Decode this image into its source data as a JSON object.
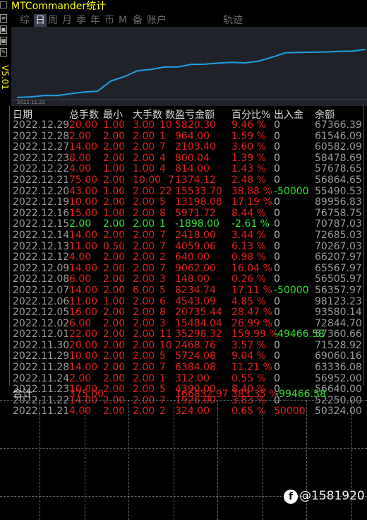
{
  "window": {
    "title": "MTCommander统计"
  },
  "sidebar": {
    "version": "V5.01"
  },
  "tabs": [
    {
      "label": "综"
    },
    {
      "label": "日"
    },
    {
      "label": "周"
    },
    {
      "label": "月"
    },
    {
      "label": "季"
    },
    {
      "label": "年"
    },
    {
      "label": "币"
    },
    {
      "label": "M"
    },
    {
      "label": "备"
    },
    {
      "label": "账户"
    },
    {
      "label": "轨迹"
    }
  ],
  "chart": {
    "date_label": "2022.11.21",
    "line_color": "#1ea0e6"
  },
  "chart_data": {
    "type": "line",
    "x": [
      "2022.11.21",
      "2022.11.22",
      "2022.11.23",
      "2022.11.24",
      "2022.11.25",
      "2022.11.28",
      "2022.11.29",
      "2022.11.30",
      "2022.12.01",
      "2022.12.02",
      "2022.12.05",
      "2022.12.06",
      "2022.12.07",
      "2022.12.08",
      "2022.12.09",
      "2022.12.12",
      "2022.12.13",
      "2022.12.14",
      "2022.12.15",
      "2022.12.16",
      "2022.12.19",
      "2022.12.20",
      "2022.12.21",
      "2022.12.22",
      "2022.12.23",
      "2022.12.27",
      "2022.12.28",
      "2022.12.29"
    ],
    "series": [
      {
        "values": [
          50324.0,
          52250.0,
          56640.0,
          56952.0,
          57289.0,
          63336.08,
          69060.16,
          71528.92,
          57360.66,
          72844.7,
          93580.14,
          98123.23,
          56357.97,
          56505.97,
          65567.97,
          66207.97,
          70267.03,
          72685.03,
          70787.03,
          76758.75,
          89956.83,
          55490.53,
          56864.65,
          57678.65,
          58478.69,
          60582.09,
          61546.09,
          67366.39
        ]
      }
    ],
    "title": "",
    "xlabel": "",
    "ylabel": ""
  },
  "table": {
    "headers": {
      "date": "日期",
      "lots": "总手数",
      "min": "最小",
      "max": "大手数",
      "count": "数",
      "pnl": "盈亏金额",
      "pct": "百分比%",
      "flow": "出入金",
      "balance": "余额"
    },
    "rows": [
      {
        "date": "2022.12.29",
        "lots": "20.00",
        "min": "1.00",
        "max": "3.00",
        "count": "10",
        "pnl": "5820.30",
        "pct": "9.46 %",
        "flow": "0",
        "balance": "67366.39",
        "color": "red"
      },
      {
        "date": "2022.12.28",
        "lots": "2.00",
        "min": "2.00",
        "max": "2.00",
        "count": "1",
        "pnl": "964.00",
        "pct": "1.59 %",
        "flow": "0",
        "balance": "61546.09",
        "color": "red"
      },
      {
        "date": "2022.12.27",
        "lots": "14.00",
        "min": "2.00",
        "max": "2.00",
        "count": "7",
        "pnl": "2103.40",
        "pct": "3.60 %",
        "flow": "0",
        "balance": "60582.09",
        "color": "red"
      },
      {
        "date": "2022.12.23",
        "lots": "8.00",
        "min": "2.00",
        "max": "2.00",
        "count": "4",
        "pnl": "800.04",
        "pct": "1.39 %",
        "flow": "0",
        "balance": "58478.69",
        "color": "red"
      },
      {
        "date": "2022.12.22",
        "lots": "4.00",
        "min": "1.00",
        "max": "1.00",
        "count": "4",
        "pnl": "814.00",
        "pct": "1.43 %",
        "flow": "0",
        "balance": "57678.65",
        "color": "red"
      },
      {
        "date": "2022.12.21",
        "lots": "75.00",
        "min": "2.00",
        "max": "10.00",
        "count": "7",
        "pnl": "1374.12",
        "pct": "2.48 %",
        "flow": "0",
        "balance": "56864.65",
        "color": "red"
      },
      {
        "date": "2022.12.20",
        "lots": "43.00",
        "min": "1.00",
        "max": "2.00",
        "count": "22",
        "pnl": "15533.70",
        "pct": "38.88 %",
        "flow": "-50000",
        "balance": "55490.53",
        "color": "red"
      },
      {
        "date": "2022.12.19",
        "lots": "10.00",
        "min": "2.00",
        "max": "2.00",
        "count": "5",
        "pnl": "13198.08",
        "pct": "17.19 %",
        "flow": "0",
        "balance": "89956.83",
        "color": "red"
      },
      {
        "date": "2022.12.16",
        "lots": "15.00",
        "min": "1.00",
        "max": "2.00",
        "count": "8",
        "pnl": "5971.72",
        "pct": "8.44 %",
        "flow": "0",
        "balance": "76758.75",
        "color": "red"
      },
      {
        "date": "2022.12.15",
        "lots": "2.00",
        "min": "2.00",
        "max": "2.00",
        "count": "1",
        "pnl": "-1898.00",
        "pct": "-2.61 %",
        "flow": "0",
        "balance": "70787.03",
        "color": "green"
      },
      {
        "date": "2022.12.14",
        "lots": "14.00",
        "min": "2.00",
        "max": "2.00",
        "count": "7",
        "pnl": "2418.00",
        "pct": "3.44 %",
        "flow": "0",
        "balance": "72685.03",
        "color": "red"
      },
      {
        "date": "2022.12.13",
        "lots": "11.00",
        "min": "0.50",
        "max": "2.00",
        "count": "7",
        "pnl": "4059.06",
        "pct": "6.13 %",
        "flow": "0",
        "balance": "70267.03",
        "color": "red"
      },
      {
        "date": "2022.12.12",
        "lots": "4.00",
        "min": "2.00",
        "max": "2.00",
        "count": "2",
        "pnl": "640.00",
        "pct": "0.98 %",
        "flow": "0",
        "balance": "66207.97",
        "color": "red"
      },
      {
        "date": "2022.12.09",
        "lots": "14.00",
        "min": "2.00",
        "max": "2.00",
        "count": "7",
        "pnl": "9062.00",
        "pct": "16.04 %",
        "flow": "0",
        "balance": "65567.97",
        "color": "red"
      },
      {
        "date": "2022.12.08",
        "lots": "6.00",
        "min": "2.00",
        "max": "2.00",
        "count": "3",
        "pnl": "148.00",
        "pct": "0.26 %",
        "flow": "0",
        "balance": "56505.97",
        "color": "red"
      },
      {
        "date": "2022.12.07",
        "lots": "14.00",
        "min": "2.00",
        "max": "6.00",
        "count": "5",
        "pnl": "8234.74",
        "pct": "17.11 %",
        "flow": "-50000",
        "balance": "56357.97",
        "color": "red"
      },
      {
        "date": "2022.12.06",
        "lots": "11.00",
        "min": "1.00",
        "max": "2.00",
        "count": "6",
        "pnl": "4543.09",
        "pct": "4.85 %",
        "flow": "0",
        "balance": "98123.23",
        "color": "red"
      },
      {
        "date": "2022.12.05",
        "lots": "16.00",
        "min": "2.00",
        "max": "2.00",
        "count": "8",
        "pnl": "20735.44",
        "pct": "28.47 %",
        "flow": "0",
        "balance": "93580.14",
        "color": "red"
      },
      {
        "date": "2022.12.02",
        "lots": "6.00",
        "min": "2.00",
        "max": "2.00",
        "count": "3",
        "pnl": "15484.04",
        "pct": "26.99 %",
        "flow": "0",
        "balance": "72844.70",
        "color": "red"
      },
      {
        "date": "2022.12.01",
        "lots": "22.00",
        "min": "2.00",
        "max": "2.00",
        "count": "11",
        "pnl": "35298.32",
        "pct": "159.99 %",
        "flow": "-49466.58",
        "balance": "57360.66",
        "color": "red"
      },
      {
        "date": "2022.11.30",
        "lots": "20.00",
        "min": "2.00",
        "max": "2.00",
        "count": "10",
        "pnl": "2468.76",
        "pct": "3.57 %",
        "flow": "0",
        "balance": "71528.92",
        "color": "red"
      },
      {
        "date": "2022.11.29",
        "lots": "10.00",
        "min": "2.00",
        "max": "2.00",
        "count": "5",
        "pnl": "5724.08",
        "pct": "9.04 %",
        "flow": "0",
        "balance": "69060.16",
        "color": "red"
      },
      {
        "date": "2022.11.28",
        "lots": "14.00",
        "min": "2.00",
        "max": "2.00",
        "count": "7",
        "pnl": "6384.08",
        "pct": "11.21 %",
        "flow": "0",
        "balance": "63336.08",
        "color": "red"
      },
      {
        "date": "2022.11.24",
        "lots": "2.00",
        "min": "2.00",
        "max": "2.00",
        "count": "1",
        "pnl": "312.00",
        "pct": "0.55 %",
        "flow": "0",
        "balance": "56952.00",
        "color": "red"
      },
      {
        "date": "2022.11.23",
        "lots": "10.00",
        "min": "2.00",
        "max": "2.00",
        "count": "5",
        "pnl": "4390.00",
        "pct": "8.40 %",
        "flow": "0",
        "balance": "56640.00",
        "color": "red"
      },
      {
        "date": "2022.11.22",
        "lots": "14.00",
        "min": "2.00",
        "max": "2.00",
        "count": "7",
        "pnl": "1926.00",
        "pct": "3.83 %",
        "flow": "0",
        "balance": "52250.00",
        "color": "red"
      },
      {
        "date": "2022.11.21",
        "lots": "4.00",
        "min": "2.00",
        "max": "2.00",
        "count": "2",
        "pnl": "324.00",
        "pct": "0.65 %",
        "flow": "50000",
        "balance": "50324.00",
        "color": "red"
      }
    ]
  },
  "total": {
    "label": "合计",
    "lots": "375.00",
    "pnl": "166832.97",
    "pct": "383.35 %",
    "flow": "-99466.58"
  },
  "watermark": {
    "text": "@1581920"
  }
}
